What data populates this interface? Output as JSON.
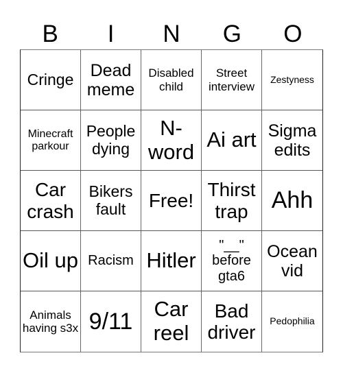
{
  "header": {
    "letters": [
      "B",
      "I",
      "N",
      "G",
      "O"
    ]
  },
  "cells": [
    "Cringe",
    "Dead meme",
    "Disabled child",
    "Street interview",
    "Zestyness",
    "Minecraft parkour",
    "People dying",
    "N-word",
    "Ai art",
    "Sigma edits",
    "Car crash",
    "Bikers fault",
    "Free!",
    "Thirst trap",
    "Ahh",
    "Oil up",
    "Racism",
    "Hitler",
    "\"__\" before gta6",
    "Ocean vid",
    "Animals having s3x",
    "9/11",
    "Car reel",
    "Bad driver",
    "Pedophilia"
  ]
}
